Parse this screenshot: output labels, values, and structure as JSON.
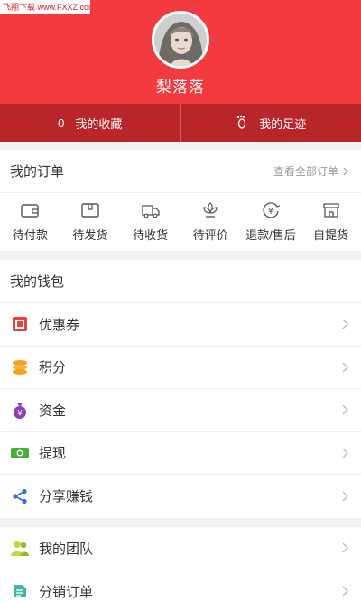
{
  "watermark": "飞翔下载 www.FXXZ.com",
  "profile": {
    "username": "梨落落"
  },
  "stats": [
    {
      "count": "0",
      "label": "我的收藏"
    },
    {
      "label": "我的足迹"
    }
  ],
  "orders": {
    "title": "我的订单",
    "view_all": "查看全部订单",
    "items": [
      {
        "label": "待付款",
        "icon": "wallet-icon"
      },
      {
        "label": "待发货",
        "icon": "package-icon"
      },
      {
        "label": "待收货",
        "icon": "truck-icon"
      },
      {
        "label": "待评价",
        "icon": "flower-icon"
      },
      {
        "label": "退款/售后",
        "icon": "yen-refund-icon"
      },
      {
        "label": "自提货",
        "icon": "store-icon"
      }
    ]
  },
  "wallet": {
    "title": "我的钱包",
    "items": [
      {
        "label": "优惠券",
        "icon": "coupon-icon"
      },
      {
        "label": "积分",
        "icon": "coins-icon"
      },
      {
        "label": "资金",
        "icon": "money-bag-icon"
      },
      {
        "label": "提现",
        "icon": "cash-icon"
      },
      {
        "label": "分享赚钱",
        "icon": "share-icon"
      }
    ]
  },
  "team": {
    "items": [
      {
        "label": "我的团队",
        "icon": "team-icon"
      },
      {
        "label": "分销订单",
        "icon": "distribution-icon"
      }
    ]
  },
  "colors": {
    "brand": "#f23a3f",
    "brand_dark": "#b8262a"
  }
}
